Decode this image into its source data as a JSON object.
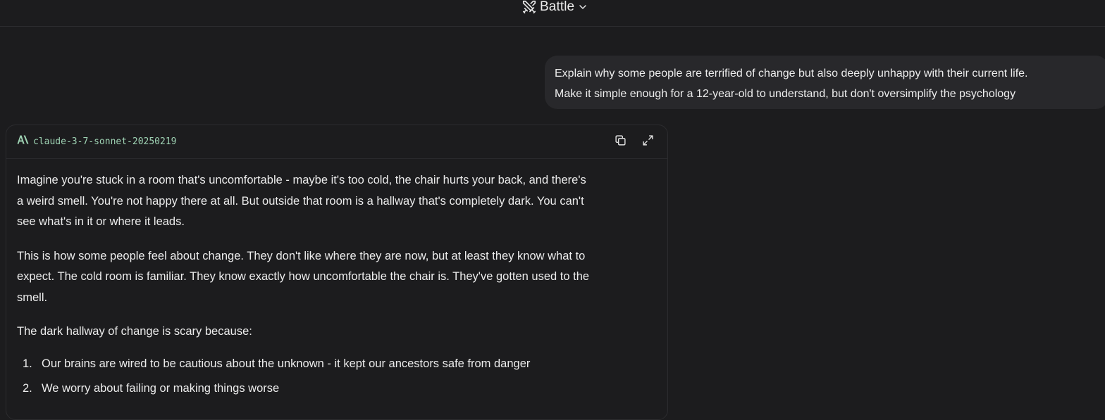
{
  "header": {
    "mode_label": "Battle"
  },
  "user_message": {
    "lines": [
      "Explain why some people are terrified of change but also deeply unhappy with their current life.",
      "Make it simple enough for a 12-year-old to understand, but don't oversimplify the psychology"
    ]
  },
  "response": {
    "model_name": "claude-3-7-sonnet-20250219",
    "paragraphs": [
      [
        "Imagine you're stuck in a room that's uncomfortable - maybe it's too cold, the chair hurts your back, and there's",
        "a weird smell. You're not happy there at all. But outside that room is a hallway that's completely dark. You can't",
        "see what's in it or where it leads."
      ],
      [
        "This is how some people feel about change. They don't like where they are now, but at least they know what to",
        "expect. The cold room is familiar. They know exactly how uncomfortable the chair is. They've gotten used to the",
        "smell."
      ],
      [
        "The dark hallway of change is scary because:"
      ]
    ],
    "list": [
      {
        "num": "1.",
        "text": "Our brains are wired to be cautious about the unknown - it kept our ancestors safe from danger"
      },
      {
        "num": "2.",
        "text": "We worry about failing or making things worse"
      }
    ]
  },
  "colors": {
    "background": "#1c1c1e",
    "bubble": "#28282b",
    "model_name": "#9fd3b4",
    "text": "#ececec"
  }
}
